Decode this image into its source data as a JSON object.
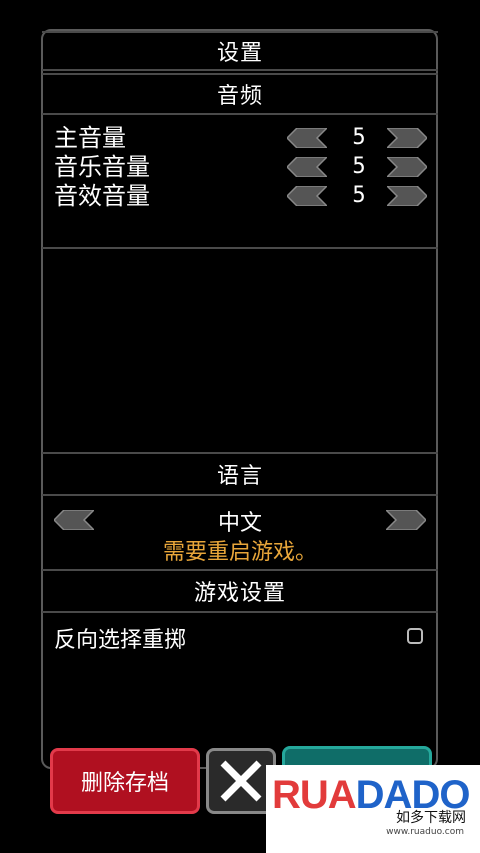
{
  "header": {
    "title": "设置"
  },
  "audio": {
    "section_title": "音频",
    "rows": [
      {
        "label": "主音量",
        "value": "5"
      },
      {
        "label": "音乐音量",
        "value": "5"
      },
      {
        "label": "音效音量",
        "value": "5"
      }
    ]
  },
  "language": {
    "section_title": "语言",
    "current": "中文",
    "notice": "需要重启游戏。"
  },
  "game_settings": {
    "section_title": "游戏设置",
    "options": [
      {
        "label": "反向选择重掷",
        "checked": false
      }
    ]
  },
  "footer": {
    "delete_label": "删除存档",
    "close_icon": "close-icon"
  },
  "watermark": {
    "logo_r": "RUA",
    "logo_b": "DADO",
    "tagline": "如多下载网",
    "url": "www.ruaduo.com"
  },
  "colors": {
    "warning": "#e8a63a",
    "delete": "#b01020",
    "confirm": "#0f6d68"
  }
}
